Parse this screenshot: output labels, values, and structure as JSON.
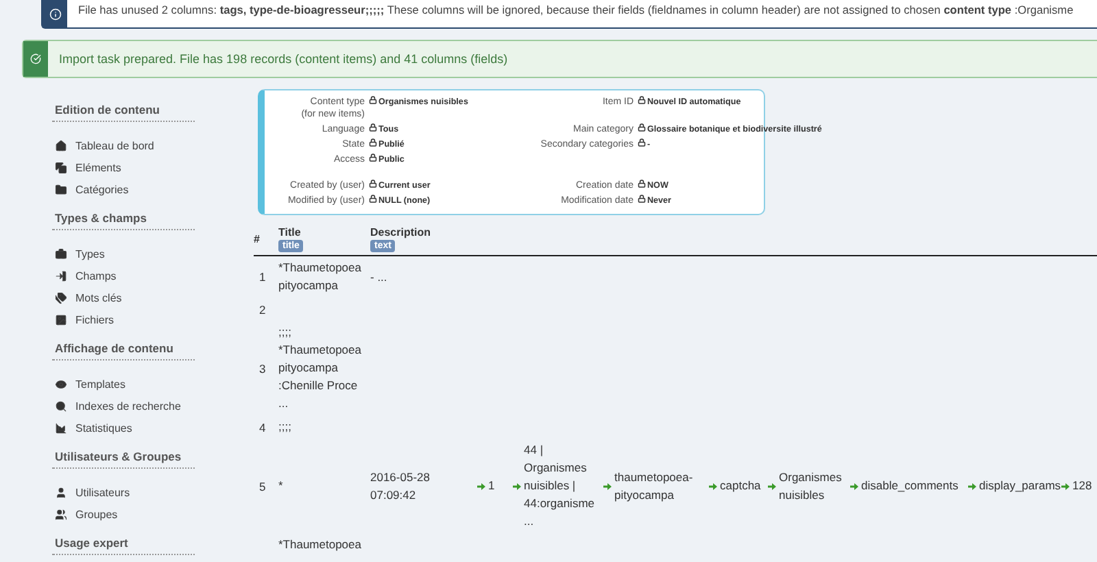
{
  "info_alert": {
    "text": "File has unused 2 columns: **tags, type-de-bioagresseur;;;;;** These columns will be ignored, because their fields (fieldnames in column header) are not assigned to chosen **content type** :Organisme"
  },
  "success_alert": {
    "text": "Import task prepared. File has 198 records (content items) and 41 columns (fields)"
  },
  "sidebar": {
    "sections": [
      {
        "heading": "Edition de contenu",
        "items": [
          {
            "label": "Tableau de bord"
          },
          {
            "label": "Eléments"
          },
          {
            "label": "Catégories"
          }
        ]
      },
      {
        "heading": "Types & champs",
        "items": [
          {
            "label": "Types"
          },
          {
            "label": "Champs"
          },
          {
            "label": "Mots clés"
          },
          {
            "label": "Fichiers"
          }
        ]
      },
      {
        "heading": "Affichage de contenu",
        "items": [
          {
            "label": "Templates"
          },
          {
            "label": "Indexes de recherche"
          },
          {
            "label": "Statistiques"
          }
        ]
      },
      {
        "heading": "Utilisateurs & Groupes",
        "items": [
          {
            "label": "Utilisateurs"
          },
          {
            "label": "Groupes"
          }
        ]
      },
      {
        "heading": "Usage expert"
      }
    ]
  },
  "info_panel": {
    "groups": [
      [
        {
          "left": {
            "label": "Content type\n(for new items)",
            "value": "Organismes nuisibles"
          },
          "right": {
            "label": "Item ID",
            "value": "Nouvel ID automatique"
          }
        },
        {
          "left": {
            "label": "Language",
            "value": "Tous"
          },
          "right": {
            "label": "Main category",
            "value": "Glossaire botanique et biodiversite illustré"
          }
        },
        {
          "left": {
            "label": "State",
            "value": "Publié"
          },
          "right": {
            "label": "Secondary categories",
            "value": "-"
          }
        },
        {
          "left": {
            "label": "Access",
            "value": "Public"
          }
        }
      ],
      [
        {
          "left": {
            "label": "Created by (user)",
            "value": "Current user"
          },
          "right": {
            "label": "Creation date",
            "value": "NOW"
          }
        },
        {
          "left": {
            "label": "Modified by (user)",
            "value": "NULL (none)"
          },
          "right": {
            "label": "Modification date",
            "value": "Never"
          }
        }
      ]
    ]
  },
  "table": {
    "columns": [
      {
        "label": "#"
      },
      {
        "label": "Title",
        "badge": "title"
      },
      {
        "label": "Description",
        "badge": "text"
      }
    ],
    "rows": [
      {
        "number": "1",
        "title": "*Thaumetopoea\npityocampa",
        "description": "- ..."
      },
      {
        "number": "2",
        "title": "",
        "description": ""
      },
      {
        "number": "3",
        "title": ";;;;\n*Thaumetopoea\npityocampa\n:Chenille Proce\n...",
        "description": ""
      },
      {
        "number": "4",
        "title": ";;;;",
        "description": ""
      },
      {
        "number": "5",
        "title": "*",
        "description": "2016-05-28\n07:09:42",
        "cells": [
          {
            "text": "1",
            "mapped": true
          },
          {
            "text": "44 |\nOrganismes\nnuisibles |\n44:organisme\n...",
            "mapped": true
          },
          {
            "text": "thaumetopoea-\npityocampa",
            "mapped": true
          },
          {
            "text": "captcha",
            "mapped": true
          },
          {
            "text": "Organismes\nnuisibles",
            "mapped": true
          },
          {
            "text": "disable_comments",
            "mapped": true
          },
          {
            "text": "display_params",
            "mapped": true
          },
          {
            "text": "128",
            "mapped": true
          }
        ]
      },
      {
        "title": "*Thaumetopoea",
        "description": ""
      }
    ]
  }
}
